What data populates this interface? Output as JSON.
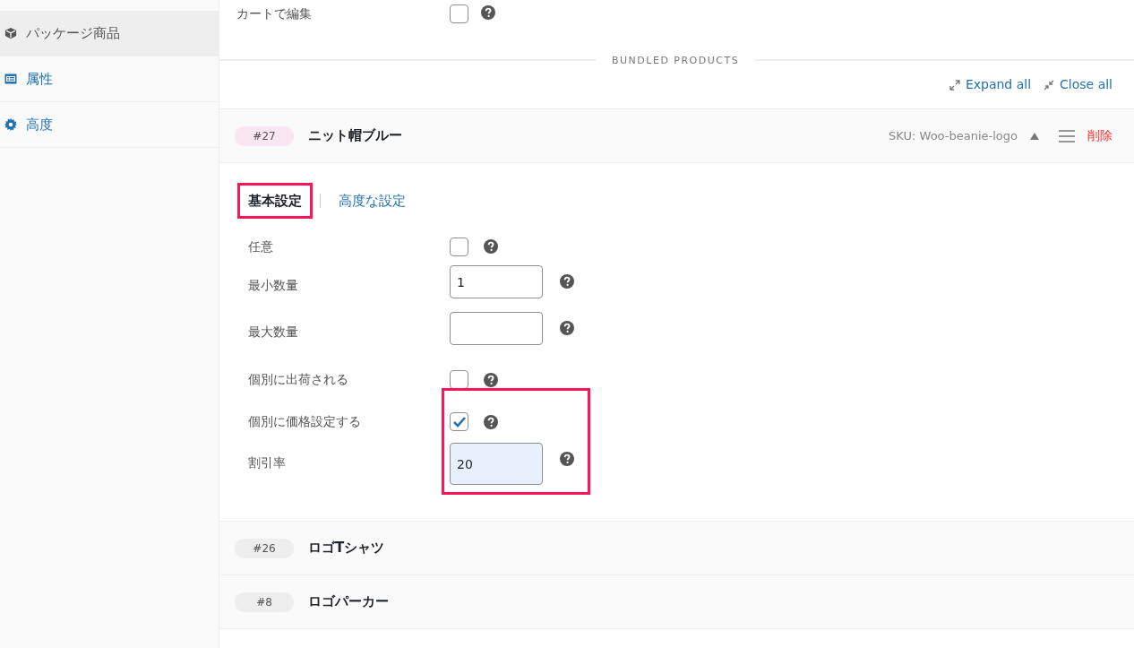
{
  "sidebar": {
    "items": [
      {
        "label": "パッケージ商品",
        "selected": true
      },
      {
        "label": "属性",
        "selected": false
      },
      {
        "label": "高度",
        "selected": false
      }
    ]
  },
  "top_field": {
    "label": "カートで編集",
    "checked": false
  },
  "section_title": "BUNDLED PRODUCTS",
  "actions": [
    {
      "label": "Expand all",
      "kind": "expand"
    },
    {
      "label": "Close all",
      "kind": "collapse"
    }
  ],
  "products": [
    {
      "id": "#27",
      "name": "ニット帽ブルー",
      "color": "#f8e6f2",
      "expanded": true,
      "sku": "SKU: Woo-beanie-logo",
      "remove": "削除",
      "tabs": [
        {
          "label": "基本設定",
          "selected": true,
          "highlighted": true
        },
        {
          "label": "高度な設定",
          "selected": false,
          "highlighted": false
        }
      ],
      "fields": [
        {
          "kind": "checkbox",
          "label": "任意",
          "checked": false,
          "highlighted": false
        },
        {
          "kind": "number",
          "label": "最小数量",
          "value": "1",
          "highlighted": false
        },
        {
          "kind": "number",
          "label": "最大数量",
          "highlighted": false
        },
        {
          "kind": "checkbox",
          "label": "個別に出荷される",
          "checked": false,
          "highlighted": false
        },
        {
          "kind": "checkbox",
          "label": "個別に価格設定する",
          "checked": true,
          "highlighted": true
        },
        {
          "kind": "number",
          "label": "割引率",
          "value": "20",
          "highlighted": true
        }
      ]
    },
    {
      "id": "#26",
      "name": "ロゴTシャツ",
      "color": "#eeeeee",
      "expanded": false
    },
    {
      "id": "#8",
      "name": "ロゴパーカー",
      "color": "#eeeeee",
      "expanded": false
    }
  ]
}
